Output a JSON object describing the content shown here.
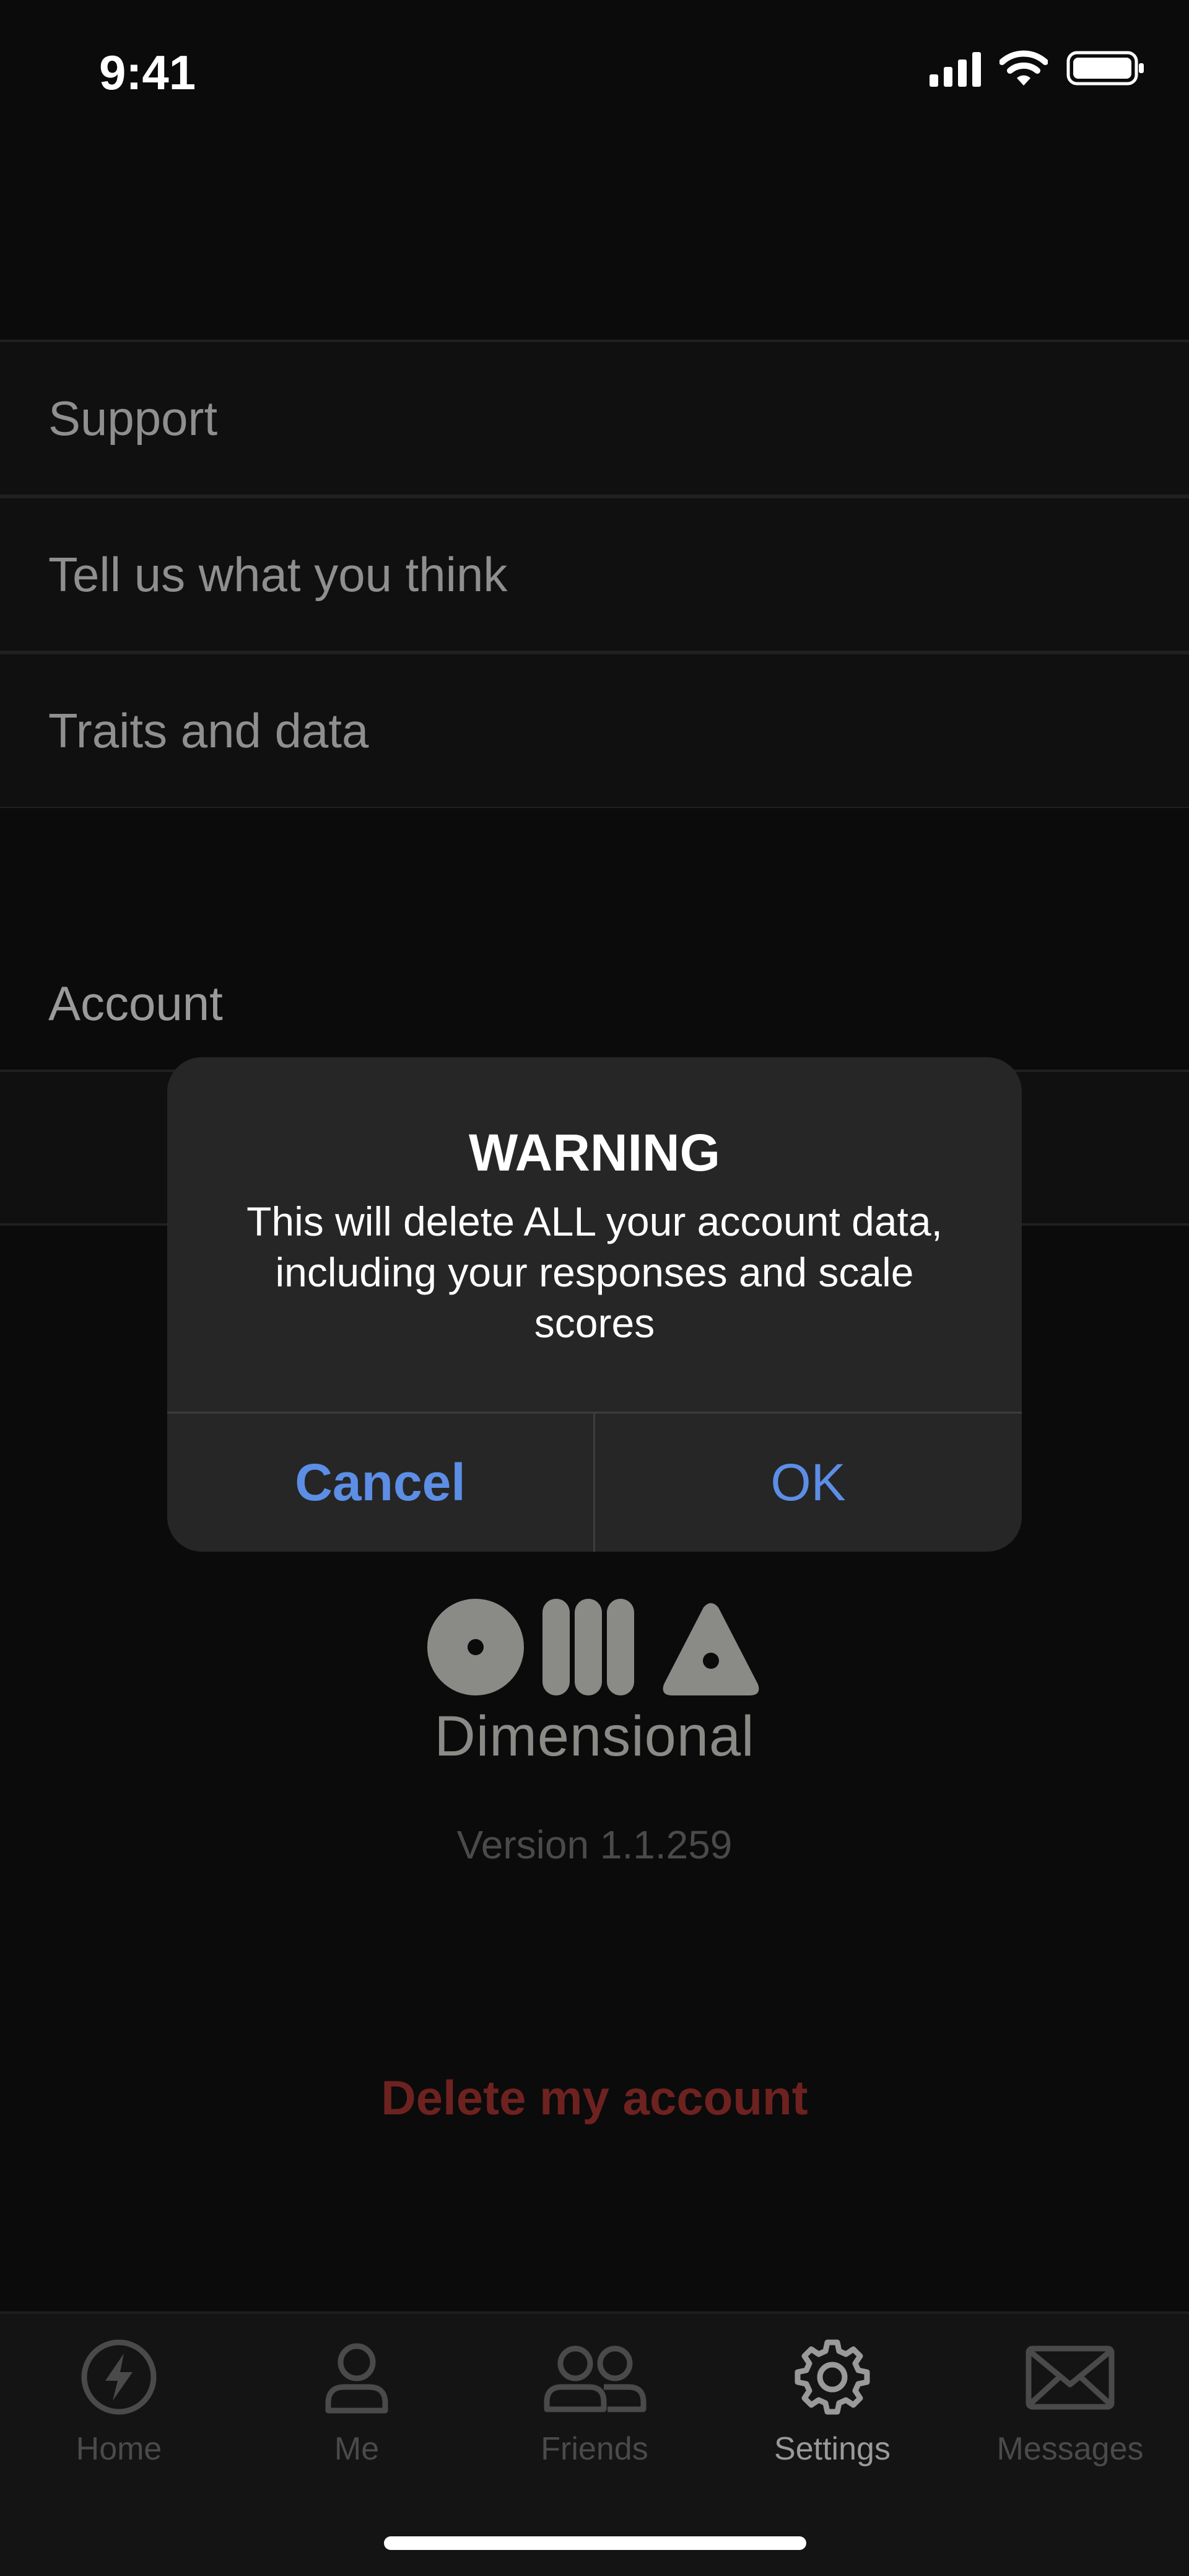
{
  "status_bar": {
    "time": "9:41"
  },
  "settings_list": {
    "items": [
      {
        "label": "Support"
      },
      {
        "label": "Tell us what you think"
      },
      {
        "label": "Traits and data"
      }
    ],
    "account_section_title": "Account"
  },
  "brand": {
    "name": "Dimensional",
    "version": "Version 1.1.259"
  },
  "delete_account_label": "Delete my account",
  "alert": {
    "title": "WARNING",
    "message": "This will delete ALL your account data, including your responses and scale scores",
    "cancel_label": "Cancel",
    "ok_label": "OK"
  },
  "tab_bar": {
    "tabs": [
      {
        "label": "Home",
        "icon": "lightning-icon",
        "active": false
      },
      {
        "label": "Me",
        "icon": "person-icon",
        "active": false
      },
      {
        "label": "Friends",
        "icon": "people-icon",
        "active": false
      },
      {
        "label": "Settings",
        "icon": "gear-icon",
        "active": true
      },
      {
        "label": "Messages",
        "icon": "envelope-icon",
        "active": false
      }
    ]
  },
  "colors": {
    "accent_blue": "#5c8ee6",
    "destructive_red": "#6e2220",
    "background": "#0b0b0b",
    "alert_background": "#262626"
  }
}
